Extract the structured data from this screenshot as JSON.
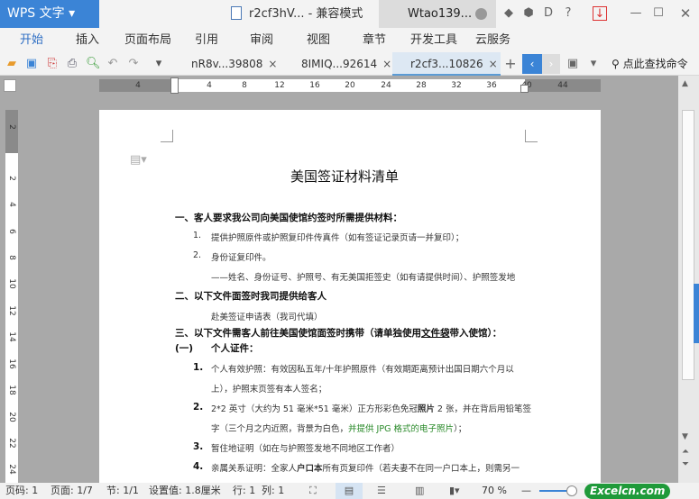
{
  "app": {
    "name": "WPS 文字",
    "title": "r2cf3hV... - 兼容模式",
    "user": "Wtao139..."
  },
  "menu": [
    "开始",
    "插入",
    "页面布局",
    "引用",
    "审阅",
    "视图",
    "章节",
    "开发工具",
    "云服务"
  ],
  "tabs": [
    {
      "label": "nR8v...39808"
    },
    {
      "label": "8IMIQ...92614"
    },
    {
      "label": "r2cf3...10826"
    }
  ],
  "search": {
    "placeholder": "点此查找命令"
  },
  "ruler_h": [
    "4",
    "4",
    "8",
    "12",
    "16",
    "20",
    "24",
    "28",
    "32",
    "36",
    "40",
    "44"
  ],
  "ruler_v": [
    "2",
    "2",
    "4",
    "6",
    "8",
    "10",
    "12",
    "14",
    "16",
    "18",
    "20",
    "22",
    "24"
  ],
  "document": {
    "title": "美国签证材料清单",
    "s1": "一、客人要求我公司向美国使馆约签时所需提供材料：",
    "s1_items": [
      {
        "n": "1.",
        "t": "提供护照原件或护照复印件传真件（如有签证记录页请一并复印）；"
      },
      {
        "n": "2.",
        "t": "身份证复印件。"
      }
    ],
    "s1_note": "——姓名、身份证号、护照号、有无美国拒签史（如有请提供时间）、护照签发地",
    "s2": "二、以下文件面签时我司提供给客人",
    "s2_text": "赴美签证申请表（我司代填）",
    "s3_a": "三、以下文件需客人前往美国使馆面签时携带（请单独使用",
    "s3_u": "文件袋",
    "s3_b": "带入使馆）：",
    "sub1_n": "(一)",
    "sub1_t": "个人证件：",
    "items": [
      {
        "n": "1.",
        "t": "个人有效护照：有效因私五年/十年护照原件（有效期距离预计出国日期六个月以",
        "t2": "上），护照末页签有本人签名；"
      },
      {
        "n": "2.",
        "t_a": "2*2 英寸（大约为 51 毫米*51 毫米）正方形彩色免冠",
        "t_b": "照片",
        "t_c": " 2 张，并在背后用铅笔签",
        "t2_a": "字（三个月之内近照，背景为白色，",
        "t2_g": "并提供 JPG 格式的电子照片",
        "t2_c": "）；"
      },
      {
        "n": "3.",
        "t": "暂住地证明（如在与护照签发地不同地区工作者）"
      },
      {
        "n": "4.",
        "t_a": "亲属关系证明：全家人",
        "t_b": "户口本",
        "t_c": "所有页复印件（若夫妻不在同一户口本上，则需另一"
      }
    ]
  },
  "status": {
    "page_no": "页码: 1",
    "pages": "页面: 1/7",
    "section": "节: 1/1",
    "setting": "设置值: 1.8厘米",
    "row": "行: 1",
    "col": "列: 1",
    "zoom": "70 %",
    "watermark": "Excelcn.com"
  },
  "colors": {
    "accent": "#3b84d6",
    "green": "#2a8a2a"
  }
}
